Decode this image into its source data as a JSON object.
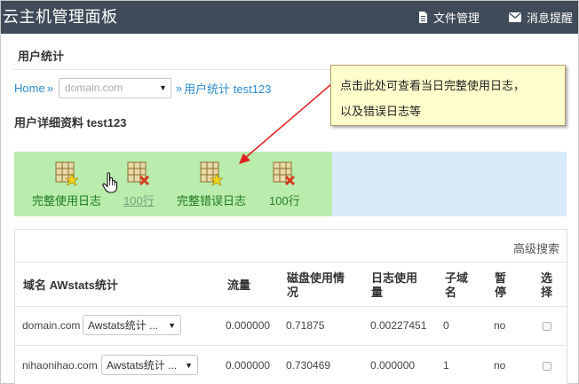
{
  "header": {
    "title": "云主机管理面板",
    "file_manager": "文件管理",
    "messages": "消息提醒"
  },
  "section_title": "用户统计",
  "breadcrumb": {
    "home": "Home",
    "sep": "»",
    "domain_placeholder": "domain.com",
    "current": "用户统计 test123"
  },
  "detail_title": "用户详细资料 test123",
  "callout": {
    "line1": "点击此处可查看当日完整使用日志，",
    "line2": "以及错误日志等"
  },
  "log_links": [
    {
      "label": "完整使用日志"
    },
    {
      "label": "100行"
    },
    {
      "label": "完整错误日志"
    },
    {
      "label": "100行"
    }
  ],
  "table": {
    "advanced_search": "高级搜索",
    "headers": {
      "domain": "域名 AWstats统计",
      "traffic": "流量",
      "disk_1": "磁盘使用情",
      "disk_2": "况",
      "log_1": "日志使用",
      "log_2": "量",
      "sub_1": "子域",
      "sub_2": "名",
      "pause_1": "暂",
      "pause_2": "停",
      "select_1": "选",
      "select_2": "择"
    },
    "rows": [
      {
        "domain": "domain.com",
        "awstats": "Awstats统计 ...",
        "traffic": "0.000000",
        "disk": "0.71875",
        "log": "0.00227451",
        "subdomains": "0",
        "paused": "no"
      },
      {
        "domain": "nihaonihao.com",
        "awstats": "Awstats统计 ...",
        "traffic": "0.000000",
        "disk": "0.730469",
        "log": "0.000000",
        "subdomains": "1",
        "paused": "no"
      }
    ]
  },
  "colors": {
    "topbar": "#3f4b59",
    "link": "#2a8bcf",
    "logs_bg": "#b9ecad",
    "callout_bg": "#ffffcc",
    "arrow": "#e02020"
  }
}
